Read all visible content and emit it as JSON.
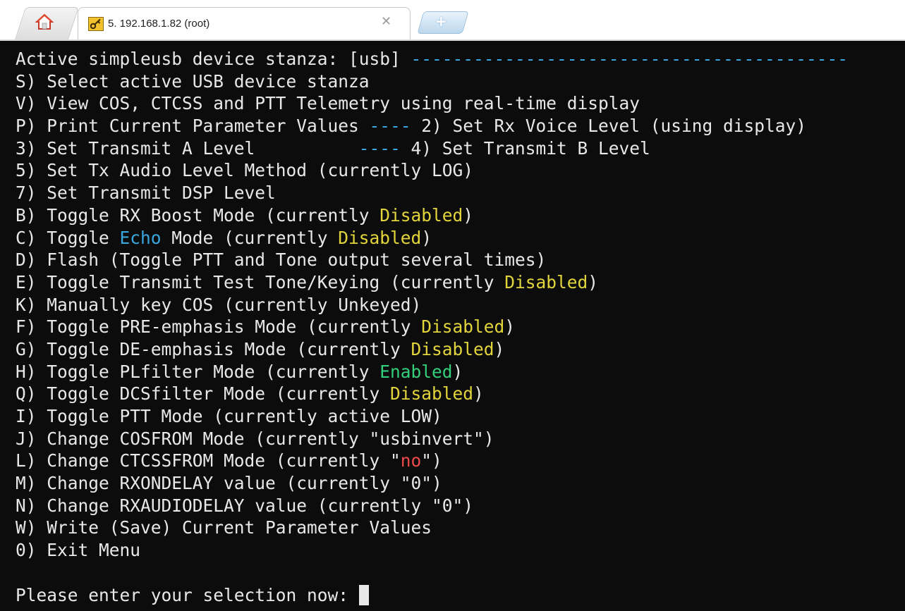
{
  "tabs": {
    "home_icon": "home-icon",
    "session_icon": "key-icon",
    "session_title": "5. 192.168.1.82 (root)",
    "close_glyph": "✕",
    "new_tab_glyph": "+"
  },
  "colors": {
    "terminal_background": "#0c0c0c",
    "default_text": "#e8e8e8",
    "cyan": "#3aa6dd",
    "yellow": "#e2d53c",
    "green": "#33cf7a",
    "red": "#ee4a4a"
  },
  "terminal": {
    "lines": [
      [
        {
          "text": "Active simpleusb device stanza: [usb] "
        },
        {
          "text": "------------------------------------------",
          "color": "cyan"
        }
      ],
      [
        {
          "text": "S) Select active USB device stanza"
        }
      ],
      [
        {
          "text": "V) View COS, CTCSS and PTT Telemetry using real-time display"
        }
      ],
      [
        {
          "text": "P) Print Current Parameter Values "
        },
        {
          "text": "----",
          "color": "cyan"
        },
        {
          "text": " 2) Set Rx Voice Level (using display)"
        }
      ],
      [
        {
          "text": "3) Set Transmit A Level          "
        },
        {
          "text": "----",
          "color": "cyan"
        },
        {
          "text": " 4) Set Transmit B Level"
        }
      ],
      [
        {
          "text": "5) Set Tx Audio Level Method (currently LOG)"
        }
      ],
      [
        {
          "text": "7) Set Transmit DSP Level"
        }
      ],
      [
        {
          "text": "B) Toggle RX Boost Mode (currently "
        },
        {
          "text": "Disabled",
          "color": "yellow"
        },
        {
          "text": ")"
        }
      ],
      [
        {
          "text": "C) Toggle "
        },
        {
          "text": "Echo",
          "color": "cyan"
        },
        {
          "text": " Mode (currently "
        },
        {
          "text": "Disabled",
          "color": "yellow"
        },
        {
          "text": ")"
        }
      ],
      [
        {
          "text": "D) Flash (Toggle PTT and Tone output several times)"
        }
      ],
      [
        {
          "text": "E) Toggle Transmit Test Tone/Keying (currently "
        },
        {
          "text": "Disabled",
          "color": "yellow"
        },
        {
          "text": ")"
        }
      ],
      [
        {
          "text": "K) Manually key COS (currently Unkeyed)"
        }
      ],
      [
        {
          "text": "F) Toggle PRE-emphasis Mode (currently "
        },
        {
          "text": "Disabled",
          "color": "yellow"
        },
        {
          "text": ")"
        }
      ],
      [
        {
          "text": "G) Toggle DE-emphasis Mode (currently "
        },
        {
          "text": "Disabled",
          "color": "yellow"
        },
        {
          "text": ")"
        }
      ],
      [
        {
          "text": "H) Toggle PLfilter Mode (currently "
        },
        {
          "text": "Enabled",
          "color": "green"
        },
        {
          "text": ")"
        }
      ],
      [
        {
          "text": "Q) Toggle DCSfilter Mode (currently "
        },
        {
          "text": "Disabled",
          "color": "yellow"
        },
        {
          "text": ")"
        }
      ],
      [
        {
          "text": "I) Toggle PTT Mode (currently active LOW)"
        }
      ],
      [
        {
          "text": "J) Change COSFROM Mode (currently \"usbinvert\")"
        }
      ],
      [
        {
          "text": "L) Change CTCSSFROM Mode (currently \""
        },
        {
          "text": "no",
          "color": "red"
        },
        {
          "text": "\")"
        }
      ],
      [
        {
          "text": "M) Change RXONDELAY value (currently \"0\")"
        }
      ],
      [
        {
          "text": "N) Change RXAUDIODELAY value (currently \"0\")"
        }
      ],
      [
        {
          "text": "W) Write (Save) Current Parameter Values"
        }
      ],
      [
        {
          "text": "0) Exit Menu"
        }
      ],
      [
        {
          "text": ""
        }
      ],
      [
        {
          "text": "Please enter your selection now: "
        }
      ]
    ]
  }
}
